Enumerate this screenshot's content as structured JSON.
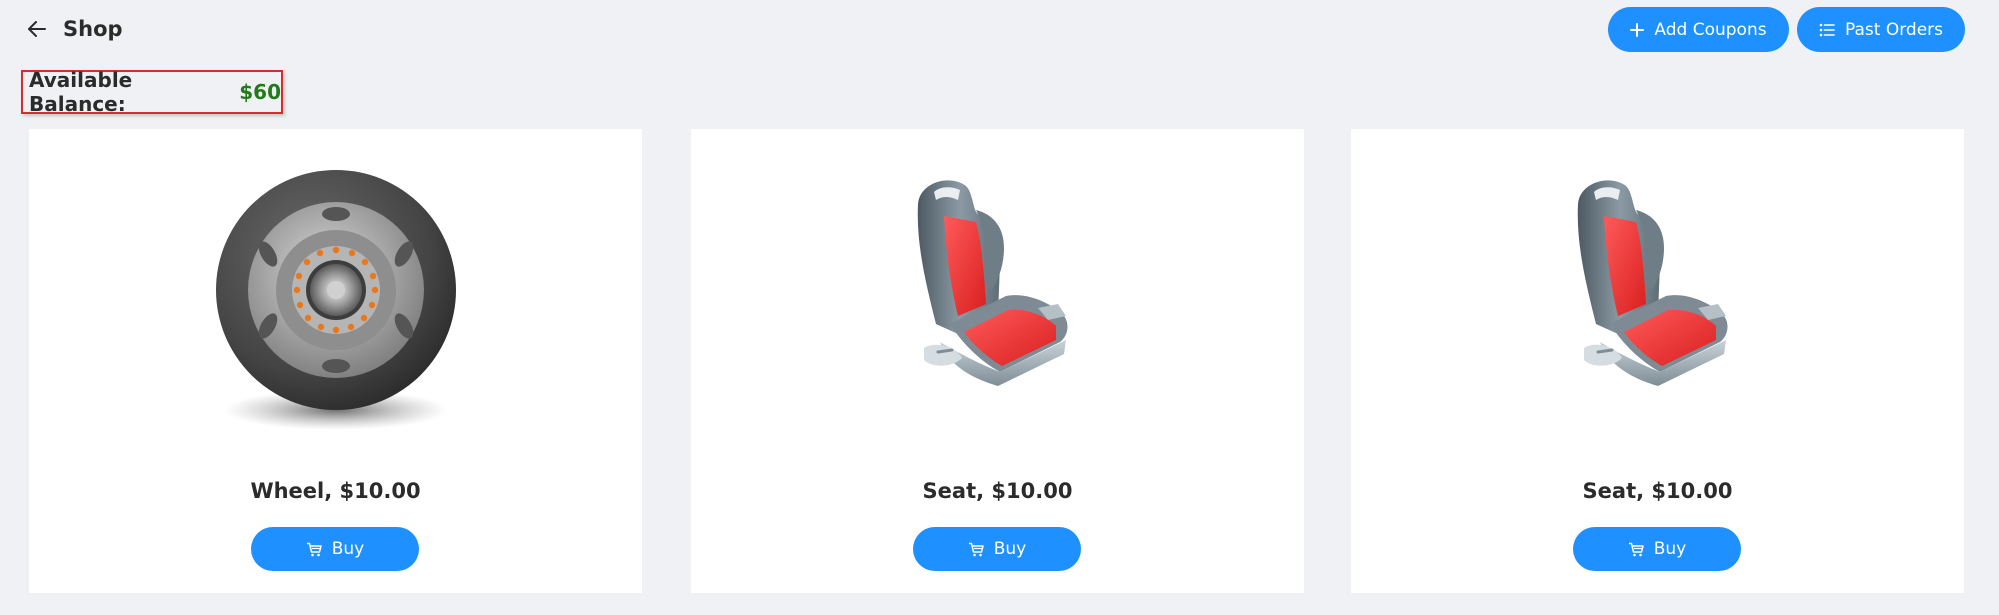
{
  "header": {
    "back_icon": "arrow-left-icon",
    "title": "Shop",
    "add_coupons_label": "Add Coupons",
    "add_coupons_icon": "plus-icon",
    "past_orders_label": "Past Orders",
    "past_orders_icon": "list-icon"
  },
  "balance": {
    "label": "Available Balance:",
    "value": "$60"
  },
  "products": [
    {
      "name": "Wheel, $10.00",
      "image": "wheel-image",
      "buy_label": "Buy",
      "buy_icon": "cart-icon"
    },
    {
      "name": "Seat, $10.00",
      "image": "car-seat-image",
      "buy_label": "Buy",
      "buy_icon": "cart-icon"
    },
    {
      "name": "Seat, $10.00",
      "image": "car-seat-image",
      "buy_label": "Buy",
      "buy_icon": "cart-icon"
    }
  ],
  "colors": {
    "accent": "#1e90ff",
    "background": "#eff1f5",
    "balance_value": "#237a1b",
    "highlight_border": "#d42d2d"
  }
}
